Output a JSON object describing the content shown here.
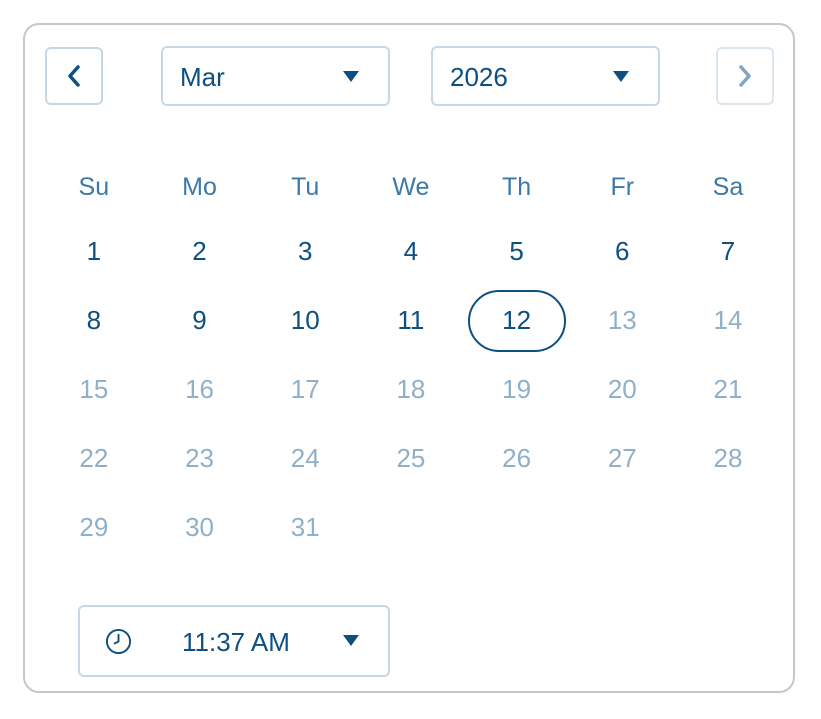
{
  "header": {
    "month": "Mar",
    "year": "2026",
    "prev_icon": "chevron-left-icon",
    "next_icon": "chevron-right-icon"
  },
  "weekdays": [
    "Su",
    "Mo",
    "Tu",
    "We",
    "Th",
    "Fr",
    "Sa"
  ],
  "days": [
    {
      "label": "1",
      "state": "enabled"
    },
    {
      "label": "2",
      "state": "enabled"
    },
    {
      "label": "3",
      "state": "enabled"
    },
    {
      "label": "4",
      "state": "enabled"
    },
    {
      "label": "5",
      "state": "enabled"
    },
    {
      "label": "6",
      "state": "enabled"
    },
    {
      "label": "7",
      "state": "enabled"
    },
    {
      "label": "8",
      "state": "enabled"
    },
    {
      "label": "9",
      "state": "enabled"
    },
    {
      "label": "10",
      "state": "enabled"
    },
    {
      "label": "11",
      "state": "enabled"
    },
    {
      "label": "12",
      "state": "selected"
    },
    {
      "label": "13",
      "state": "disabled"
    },
    {
      "label": "14",
      "state": "disabled"
    },
    {
      "label": "15",
      "state": "disabled"
    },
    {
      "label": "16",
      "state": "disabled"
    },
    {
      "label": "17",
      "state": "disabled"
    },
    {
      "label": "18",
      "state": "disabled"
    },
    {
      "label": "19",
      "state": "disabled"
    },
    {
      "label": "20",
      "state": "disabled"
    },
    {
      "label": "21",
      "state": "disabled"
    },
    {
      "label": "22",
      "state": "disabled"
    },
    {
      "label": "23",
      "state": "disabled"
    },
    {
      "label": "24",
      "state": "disabled"
    },
    {
      "label": "25",
      "state": "disabled"
    },
    {
      "label": "26",
      "state": "disabled"
    },
    {
      "label": "27",
      "state": "disabled"
    },
    {
      "label": "28",
      "state": "disabled"
    },
    {
      "label": "29",
      "state": "disabled"
    },
    {
      "label": "30",
      "state": "disabled"
    },
    {
      "label": "31",
      "state": "disabled"
    }
  ],
  "time": {
    "value": "11:37 AM",
    "icon": "clock-icon"
  },
  "colors": {
    "accent": "#0d4f80",
    "weekday": "#3b79a8",
    "disabled": "#8fb0c8",
    "border": "#c7d7e4"
  }
}
